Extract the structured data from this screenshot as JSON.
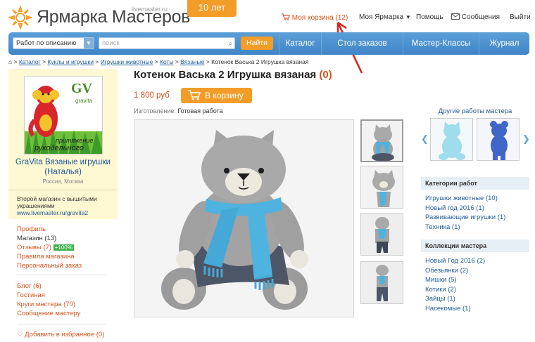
{
  "header": {
    "logo_text": "Ярмарка Мастеров",
    "logo_sub": "livemaster.ru",
    "years_badge": "10 лет",
    "cart_label": "Моя корзина (12)",
    "my_fair": "Моя Ярмарка",
    "help": "Помощь",
    "messages": "Сообщения",
    "logout": "Выйти"
  },
  "search": {
    "mode": "Работ по описанию",
    "placeholder": "поиск",
    "button": "Найти"
  },
  "nav": [
    "Каталог",
    "Стол заказов",
    "Мастер-Классы",
    "Журнал"
  ],
  "breadcrumb": {
    "items": [
      "Каталог",
      "Куклы и игрушки",
      "Игрушки животные",
      "Коты",
      "Вязаные"
    ],
    "current": "Котенок Васька 2 Игрушка вязаная"
  },
  "shop": {
    "avatar_brand": "GV",
    "avatar_brand_sub": "gravita",
    "avatar_caption_1": "притяжение",
    "avatar_caption_2": "рукодельного",
    "name": "GraVita Вязаные игрушки (Наталья)",
    "city": "Россия, Москва",
    "second_shop": "Второй магазин с вышитыми украшениями",
    "second_url": "www.livemaster.ru/gravita2",
    "menu1": [
      {
        "label": "Профиль",
        "style": "red"
      },
      {
        "label": "Магазин (13)",
        "style": "dark"
      },
      {
        "label": "Отзывы (7)",
        "style": "red",
        "badge": "+100%"
      },
      {
        "label": "Правила магазина",
        "style": "red"
      },
      {
        "label": "Персональный заказ",
        "style": "red"
      }
    ],
    "menu2": [
      {
        "label": "Блог (6)"
      },
      {
        "label": "Гостиная"
      },
      {
        "label": "Круги мастера (70)"
      },
      {
        "label": "Сообщение мастеру"
      }
    ],
    "favorite": "Добавить в избранное (0)"
  },
  "product": {
    "title": "Котенок Васька 2 Игрушка вязаная",
    "fav_count": "(0)",
    "price": "1 800 руб",
    "cart_button": "В корзину",
    "made_label": "Изготовление:",
    "made_value": "Готовая работа"
  },
  "right": {
    "other_works": "Другие работы мастера",
    "categories_title": "Категории работ",
    "categories": [
      "Игрушки животные (10)",
      "Новый год 2016 (1)",
      "Развивающие игрушки (1)",
      "Техника (1)"
    ],
    "collections_title": "Коллекции мастера",
    "collections": [
      "Новый Год 2016 (2)",
      "Обезьянки (2)",
      "Мишки (5)",
      "Котики (2)",
      "Зайцы (1)",
      "Насекомые (1)"
    ]
  },
  "colors": {
    "accent": "#f39c28",
    "nav_blue": "#3f84c6",
    "link": "#1f5c99",
    "red": "#d9531e",
    "scarf": "#4fb3e0"
  }
}
